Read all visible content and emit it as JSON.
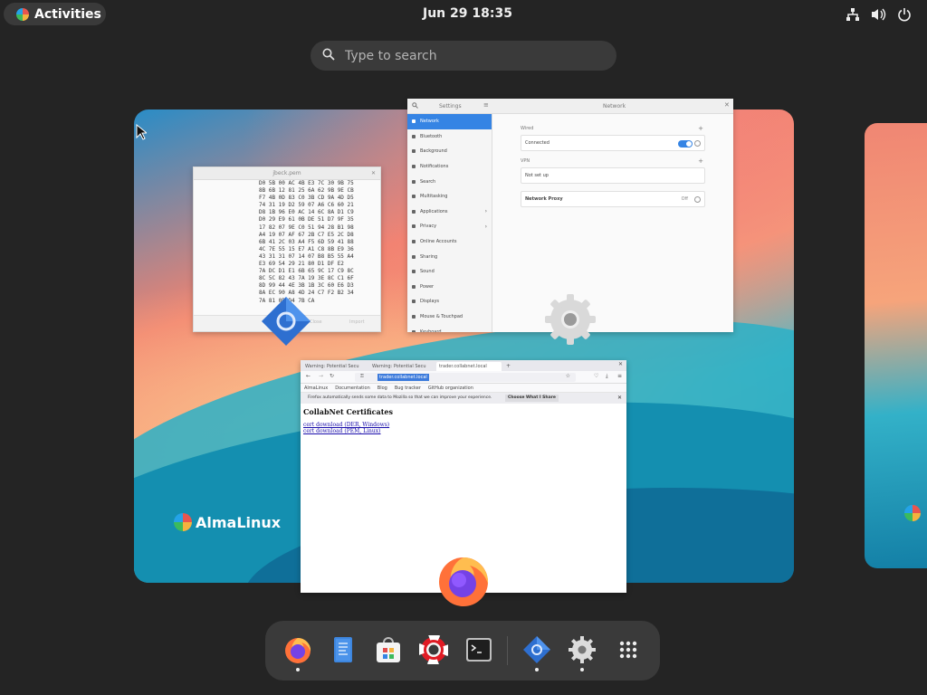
{
  "topbar": {
    "activities_label": "Activities",
    "clock": "Jun 29  18:35",
    "tray_icons": [
      "network-icon",
      "volume-icon",
      "power-icon"
    ]
  },
  "search": {
    "placeholder": "Type to search"
  },
  "workspace": {
    "brand_text": "AlmaLinux"
  },
  "windows": {
    "pem": {
      "title": "jbeck.pem",
      "hex": "D0 5B 00 AC 4B E3 7C 30 9B 75\n8B 6B 12 81 25 6A 62 9B 9E CB\nF7 4B 0D 83 C0 3B CD 9A 4D D5\n74 31 19 D2 59 07 A6 C6 60 21\nD8 1B 96 E0 AC 14 6C 8A D1 C9\nD0 29 E9 61 0B DE 51 D7 9F 35\n17 82 07 9E C0 51 94 28 B1 98\nA4 19 07 AF 67 2B C7 E5 2C D8\n6B 41 2C 03 A4 F5 6D 59 41 88\n4C 7E 55 15 E7 A1 C8 8B E9 36\n43 31 31 07 14 07 B8 B5 55 A4\nE3 69 54 29 21 80 D1 DF E2\n7A DC D1 E1 6B 65 9C 17 C9 8C\n8C 5C 82 43 7A 19 3E 8C C1 6F\n8D 99 44 4E 3B 1B 3C 60 E6 D3\n8A EC 90 A8 4D 24 C7 F2 B2 34\n7A 81 0B D4 7B CA",
      "button_cancel": "Close",
      "button_ok": "Import"
    },
    "settings": {
      "sidebar_title": "Settings",
      "page_title": "Network",
      "sidebar_items": [
        {
          "label": "Network",
          "active": true,
          "chevron": false
        },
        {
          "label": "Bluetooth",
          "active": false,
          "chevron": false
        },
        {
          "label": "Background",
          "active": false,
          "chevron": false
        },
        {
          "label": "Notifications",
          "active": false,
          "chevron": false
        },
        {
          "label": "Search",
          "active": false,
          "chevron": false
        },
        {
          "label": "Multitasking",
          "active": false,
          "chevron": false
        },
        {
          "label": "Applications",
          "active": false,
          "chevron": true
        },
        {
          "label": "Privacy",
          "active": false,
          "chevron": true
        },
        {
          "label": "Online Accounts",
          "active": false,
          "chevron": false
        },
        {
          "label": "Sharing",
          "active": false,
          "chevron": false
        },
        {
          "label": "Sound",
          "active": false,
          "chevron": false
        },
        {
          "label": "Power",
          "active": false,
          "chevron": false
        },
        {
          "label": "Displays",
          "active": false,
          "chevron": false
        },
        {
          "label": "Mouse & Touchpad",
          "active": false,
          "chevron": false
        },
        {
          "label": "Keyboard",
          "active": false,
          "chevron": false
        }
      ],
      "wired_heading": "Wired",
      "wired_status": "Connected",
      "vpn_heading": "VPN",
      "vpn_status": "Not set up",
      "proxy_label": "Network Proxy",
      "proxy_value": "Off"
    },
    "firefox": {
      "tabs": [
        "Warning: Potential Secu",
        "Warning: Potential Secu",
        "trader.collabnet.local"
      ],
      "url": "trader.collabnet.local",
      "bookmarks": [
        "AlmaLinux",
        "Documentation",
        "Blog",
        "Bug tracker",
        "GitHub organization"
      ],
      "notice": "Firefox automatically sends some data to Mozilla so that we can improve your experience.",
      "notice_button": "Choose What I Share",
      "heading": "CollabNet Certificates",
      "links": [
        "cert download (DER, Windows)",
        "cert download (PEM, Linux)"
      ]
    }
  },
  "dock": {
    "apps": [
      {
        "name": "firefox-icon",
        "running": true
      },
      {
        "name": "text-editor-icon",
        "running": false
      },
      {
        "name": "software-icon",
        "running": false
      },
      {
        "name": "help-icon",
        "running": false
      },
      {
        "name": "terminal-icon",
        "running": false
      },
      {
        "name": "certificate-viewer-icon",
        "running": true
      },
      {
        "name": "settings-icon",
        "running": true
      },
      {
        "name": "app-grid-icon",
        "running": false
      }
    ]
  },
  "colors": {
    "accent": "#3584e4",
    "panel": "#3a3a3a",
    "background": "#242424"
  }
}
